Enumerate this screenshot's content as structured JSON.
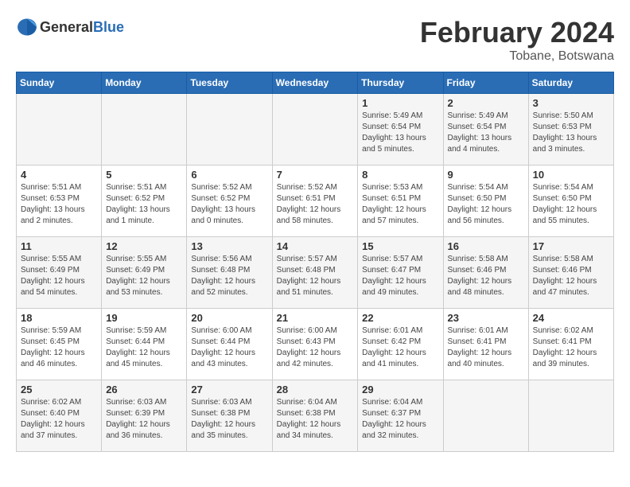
{
  "header": {
    "logo_general": "General",
    "logo_blue": "Blue",
    "month_title": "February 2024",
    "location": "Tobane, Botswana"
  },
  "calendar": {
    "days_of_week": [
      "Sunday",
      "Monday",
      "Tuesday",
      "Wednesday",
      "Thursday",
      "Friday",
      "Saturday"
    ],
    "weeks": [
      [
        {
          "day": "",
          "info": ""
        },
        {
          "day": "",
          "info": ""
        },
        {
          "day": "",
          "info": ""
        },
        {
          "day": "",
          "info": ""
        },
        {
          "day": "1",
          "info": "Sunrise: 5:49 AM\nSunset: 6:54 PM\nDaylight: 13 hours\nand 5 minutes."
        },
        {
          "day": "2",
          "info": "Sunrise: 5:49 AM\nSunset: 6:54 PM\nDaylight: 13 hours\nand 4 minutes."
        },
        {
          "day": "3",
          "info": "Sunrise: 5:50 AM\nSunset: 6:53 PM\nDaylight: 13 hours\nand 3 minutes."
        }
      ],
      [
        {
          "day": "4",
          "info": "Sunrise: 5:51 AM\nSunset: 6:53 PM\nDaylight: 13 hours\nand 2 minutes."
        },
        {
          "day": "5",
          "info": "Sunrise: 5:51 AM\nSunset: 6:52 PM\nDaylight: 13 hours\nand 1 minute."
        },
        {
          "day": "6",
          "info": "Sunrise: 5:52 AM\nSunset: 6:52 PM\nDaylight: 13 hours\nand 0 minutes."
        },
        {
          "day": "7",
          "info": "Sunrise: 5:52 AM\nSunset: 6:51 PM\nDaylight: 12 hours\nand 58 minutes."
        },
        {
          "day": "8",
          "info": "Sunrise: 5:53 AM\nSunset: 6:51 PM\nDaylight: 12 hours\nand 57 minutes."
        },
        {
          "day": "9",
          "info": "Sunrise: 5:54 AM\nSunset: 6:50 PM\nDaylight: 12 hours\nand 56 minutes."
        },
        {
          "day": "10",
          "info": "Sunrise: 5:54 AM\nSunset: 6:50 PM\nDaylight: 12 hours\nand 55 minutes."
        }
      ],
      [
        {
          "day": "11",
          "info": "Sunrise: 5:55 AM\nSunset: 6:49 PM\nDaylight: 12 hours\nand 54 minutes."
        },
        {
          "day": "12",
          "info": "Sunrise: 5:55 AM\nSunset: 6:49 PM\nDaylight: 12 hours\nand 53 minutes."
        },
        {
          "day": "13",
          "info": "Sunrise: 5:56 AM\nSunset: 6:48 PM\nDaylight: 12 hours\nand 52 minutes."
        },
        {
          "day": "14",
          "info": "Sunrise: 5:57 AM\nSunset: 6:48 PM\nDaylight: 12 hours\nand 51 minutes."
        },
        {
          "day": "15",
          "info": "Sunrise: 5:57 AM\nSunset: 6:47 PM\nDaylight: 12 hours\nand 49 minutes."
        },
        {
          "day": "16",
          "info": "Sunrise: 5:58 AM\nSunset: 6:46 PM\nDaylight: 12 hours\nand 48 minutes."
        },
        {
          "day": "17",
          "info": "Sunrise: 5:58 AM\nSunset: 6:46 PM\nDaylight: 12 hours\nand 47 minutes."
        }
      ],
      [
        {
          "day": "18",
          "info": "Sunrise: 5:59 AM\nSunset: 6:45 PM\nDaylight: 12 hours\nand 46 minutes."
        },
        {
          "day": "19",
          "info": "Sunrise: 5:59 AM\nSunset: 6:44 PM\nDaylight: 12 hours\nand 45 minutes."
        },
        {
          "day": "20",
          "info": "Sunrise: 6:00 AM\nSunset: 6:44 PM\nDaylight: 12 hours\nand 43 minutes."
        },
        {
          "day": "21",
          "info": "Sunrise: 6:00 AM\nSunset: 6:43 PM\nDaylight: 12 hours\nand 42 minutes."
        },
        {
          "day": "22",
          "info": "Sunrise: 6:01 AM\nSunset: 6:42 PM\nDaylight: 12 hours\nand 41 minutes."
        },
        {
          "day": "23",
          "info": "Sunrise: 6:01 AM\nSunset: 6:41 PM\nDaylight: 12 hours\nand 40 minutes."
        },
        {
          "day": "24",
          "info": "Sunrise: 6:02 AM\nSunset: 6:41 PM\nDaylight: 12 hours\nand 39 minutes."
        }
      ],
      [
        {
          "day": "25",
          "info": "Sunrise: 6:02 AM\nSunset: 6:40 PM\nDaylight: 12 hours\nand 37 minutes."
        },
        {
          "day": "26",
          "info": "Sunrise: 6:03 AM\nSunset: 6:39 PM\nDaylight: 12 hours\nand 36 minutes."
        },
        {
          "day": "27",
          "info": "Sunrise: 6:03 AM\nSunset: 6:38 PM\nDaylight: 12 hours\nand 35 minutes."
        },
        {
          "day": "28",
          "info": "Sunrise: 6:04 AM\nSunset: 6:38 PM\nDaylight: 12 hours\nand 34 minutes."
        },
        {
          "day": "29",
          "info": "Sunrise: 6:04 AM\nSunset: 6:37 PM\nDaylight: 12 hours\nand 32 minutes."
        },
        {
          "day": "",
          "info": ""
        },
        {
          "day": "",
          "info": ""
        }
      ]
    ]
  }
}
